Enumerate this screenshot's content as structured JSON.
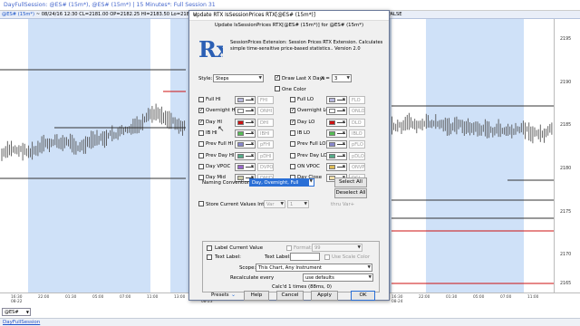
{
  "window": {
    "title": "DayFullSession: @ES# (15m*), @ES# (15m*) | 15 Minutes*: Full Session 31"
  },
  "chart_header": {
    "symbol": "@ES# (15m*)",
    "text": " ~ 08/24/16 12:30 CL=2181.00 OP=2182.25 HI=2183.50 Lo=2180.75 | 2181.10",
    "right_text": "FALSE"
  },
  "price_scale": [
    "2195",
    "2190",
    "2185",
    "2180",
    "2175",
    "2170",
    "2165"
  ],
  "time_axis": [
    "16:30\n08-22",
    "22:00",
    "01:30",
    "05:00",
    "07:00",
    "11:00",
    "13:00",
    "16:30\n08-23",
    "22:00",
    "01:30",
    "05:00",
    "07:00",
    "11:00",
    "13:00",
    "16:30\n08-24",
    "22:00",
    "01:30",
    "05:00",
    "07:00",
    "11:00"
  ],
  "symbol_box": "@ES#",
  "tab_label": "DayFullSession",
  "dialog": {
    "title": "Update RTX IsSessionPrices RTX[@ES# (15m*)]",
    "close_icon": "close-icon",
    "subtitle": "Update IsSessionPrices RTX[@ES# (15m*)] for @ES# (15m*)",
    "logo_text": "Rx",
    "description": "SessionPrices Extension: Session Prices RTX Extension. Calculates simple time-sensitive price-based statistics.. Version 2.0",
    "style_label": "Style:",
    "style_value": "Steps",
    "draw_last_label": "Draw Last X Days",
    "x_label": "X =",
    "x_value": "3",
    "one_color_label": "One Color",
    "rows_left": [
      {
        "label": "Full HI",
        "checked": false,
        "color": "#b8b8dd",
        "short": "FHI"
      },
      {
        "label": "Overnight HI",
        "checked": true,
        "color": "#ffffff",
        "short": "ONHI"
      },
      {
        "label": "Day HI",
        "checked": true,
        "color": "#cc1111",
        "short": "DHI"
      },
      {
        "label": "IB HI",
        "checked": false,
        "color": "#55bb55",
        "short": "IBHI"
      },
      {
        "label": "Prev Full HI",
        "checked": false,
        "color": "#8888cc",
        "short": "pFHI"
      },
      {
        "label": "Prev Day HI",
        "checked": false,
        "color": "#55aa88",
        "short": "pDHI"
      },
      {
        "label": "Day VPOC",
        "checked": false,
        "color": "#9966cc",
        "short": "DVPOC"
      },
      {
        "label": "Day Mid",
        "checked": false,
        "color": "#ccccaa",
        "short": "DMID"
      }
    ],
    "rows_right": [
      {
        "label": "Full LO",
        "checked": false,
        "color": "#b8b8dd",
        "short": "FLO"
      },
      {
        "label": "Overnight LO",
        "checked": true,
        "color": "#ffffff",
        "short": "ONLO"
      },
      {
        "label": "Day LO",
        "checked": true,
        "color": "#cc1111",
        "short": "DLO"
      },
      {
        "label": "IB LO",
        "checked": false,
        "color": "#55bb55",
        "short": "IBLO"
      },
      {
        "label": "Prev Full LO",
        "checked": false,
        "color": "#8888cc",
        "short": "pFLO"
      },
      {
        "label": "Prev Day LO",
        "checked": false,
        "color": "#55aa88",
        "short": "pDLO"
      },
      {
        "label": "ON VPOC",
        "checked": false,
        "color": "#ddbb55",
        "short": "ONVPOC"
      },
      {
        "label": "Day Close",
        "checked": false,
        "color": "#eeddaa",
        "short": "DCL"
      }
    ],
    "naming_label": "Naming Convention:",
    "naming_value": "Day, Overnight, Full",
    "select_all": "Select All",
    "deselect_all": "Deselect All",
    "store_label": "Store Current Values Into:",
    "store_var": "Var",
    "store_num": "1",
    "store_suffix": "thru Var+",
    "label_current": "Label Current Value",
    "format_label": "Format:",
    "format_value": "99",
    "text_label_chk": "Text Label:",
    "text_label_field": "Text Label:",
    "use_scale_color": "Use Scale Color",
    "scope_label": "Scope:",
    "scope_value": "This Chart, Any Instrument",
    "recalc_label": "Recalculate every",
    "recalc_value": "use defaults",
    "calc_status": "Calc'd 1 times (88ms, 0)",
    "presets": "Presets",
    "help": "Help",
    "cancel": "Cancel",
    "apply": "Apply",
    "ok": "OK"
  }
}
